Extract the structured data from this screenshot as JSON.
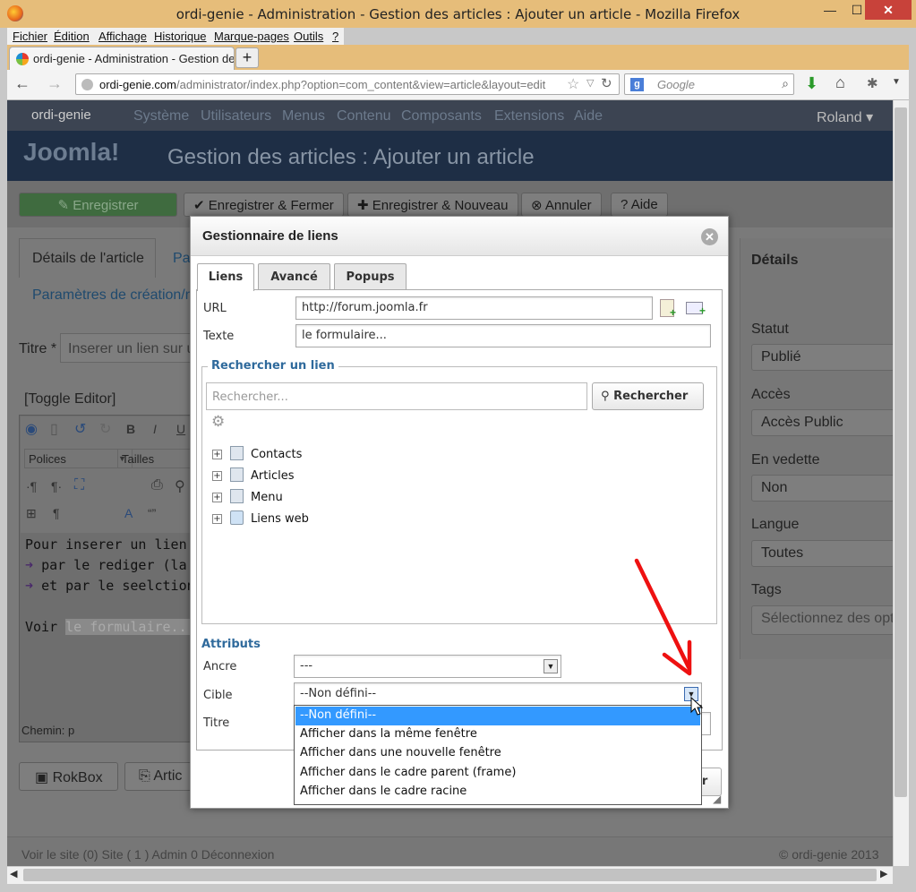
{
  "window": {
    "title": "ordi-genie - Administration - Gestion des articles : Ajouter un article - Mozilla Firefox",
    "min": "—",
    "max": "☐",
    "close": "✕"
  },
  "menubar": [
    "Fichier",
    "Édition",
    "Affichage",
    "Historique",
    "Marque-pages",
    "Outils",
    "?"
  ],
  "tab": {
    "label": "ordi-genie - Administration - Gestion de...",
    "new_tab": "+"
  },
  "nav": {
    "back": "←",
    "forward": "→",
    "url_host": "ordi-genie.com",
    "url_path": "/administrator/index.php?option=com_content&view=article&layout=edit",
    "search_placeholder": "Google",
    "search_engine": "g"
  },
  "joomla": {
    "site_name": "ordi-genie",
    "menu": [
      "Système",
      "Utilisateurs",
      "Menus",
      "Contenu",
      "Composants",
      "Extensions",
      "Aide"
    ],
    "user": "Roland ▾",
    "logo": "Joomla!",
    "page_title": "Gestion des articles : Ajouter un article",
    "toolbar": [
      "Enregistrer",
      "Enregistrer & Fermer",
      "Enregistrer & Nouveau",
      "Annuler",
      "Aide"
    ],
    "tabs": [
      "Détails de l'article",
      "Pa",
      "Paramètres de création/m"
    ],
    "title_label": "Titre *",
    "title_placeholder": "Inserer un lien sur un",
    "toggle_editor": "[Toggle Editor]",
    "fonts_select": "Polices",
    "sizes_select": "Tailles",
    "editor_lines": [
      "Pour inserer un lien sur u",
      "par le rediger (la con",
      "et par le seelctionne"
    ],
    "editor_voir": "Voir",
    "editor_link": "le formulaire...",
    "chemin": "Chemin: p",
    "rokbox": "RokBox",
    "article_btn": "Artic",
    "details_heading": "Détails",
    "right_fields": [
      {
        "label": "Statut",
        "value": "Publié"
      },
      {
        "label": "Accès",
        "value": "Accès Public"
      },
      {
        "label": "En vedette",
        "value": "Non"
      },
      {
        "label": "Langue",
        "value": "Toutes"
      },
      {
        "label": "Tags",
        "value": "Sélectionnez des opti"
      }
    ],
    "footer_left": "Voir le site  (0) Site  ( 1 ) Admin   0  Déconnexion",
    "footer_right": "© ordi-genie 2013"
  },
  "modal": {
    "title": "Gestionnaire de liens",
    "tabs": [
      "Liens",
      "Avancé",
      "Popups"
    ],
    "url_label": "URL",
    "url_value": "http://forum.joomla.fr",
    "text_label": "Texte",
    "text_value": "le formulaire...",
    "search_legend": "Rechercher un lien",
    "search_placeholder": "Rechercher...",
    "search_button": "Rechercher",
    "tree": [
      "Contacts",
      "Articles",
      "Menu",
      "Liens web"
    ],
    "attributes_heading": "Attributs",
    "anchor_label": "Ancre",
    "anchor_value": "---",
    "target_label": "Cible",
    "target_value": "--Non défini--",
    "title_label": "Titre",
    "target_options": [
      "--Non défini--",
      "Afficher dans la même fenêtre",
      "Afficher dans une nouvelle fenêtre",
      "Afficher dans le cadre parent (frame)",
      "Afficher dans le cadre racine"
    ],
    "insert_button": "er"
  },
  "colors": {
    "annotation_arrow": "#ee1111",
    "highlight": "#3399ff",
    "heading_blue": "#2f6a9c"
  }
}
